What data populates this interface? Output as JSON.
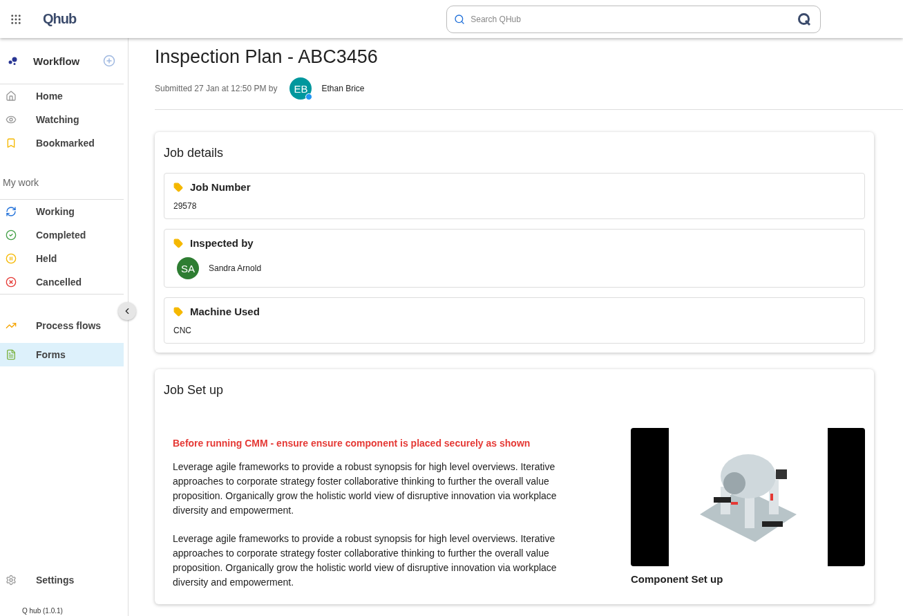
{
  "header": {
    "logo": "Qhub",
    "search": {
      "placeholder": "Search QHub"
    }
  },
  "sidebar": {
    "title": "Workflow",
    "groups": [
      {
        "items": [
          {
            "label": "Home",
            "selected": false
          },
          {
            "label": "Watching",
            "selected": false
          },
          {
            "label": "Bookmarked",
            "selected": false
          }
        ]
      },
      {
        "heading": "My work",
        "items": [
          {
            "label": "Working",
            "selected": false
          },
          {
            "label": "Completed",
            "selected": false
          },
          {
            "label": "Held",
            "selected": false
          },
          {
            "label": "Cancelled",
            "selected": false
          }
        ]
      },
      {
        "items": [
          {
            "label": "Process flows",
            "selected": false
          },
          {
            "label": "Forms",
            "selected": true
          }
        ]
      }
    ],
    "settings": "Settings",
    "version": "Q hub (1.0.1)"
  },
  "page": {
    "title": "Inspection Plan - ABC3456",
    "submitted": "Submitted 27 Jan at 12:50 PM by",
    "submitter": {
      "initials": "EB",
      "name": "Ethan Brice",
      "color": "#00979d",
      "online": true
    }
  },
  "job_details": {
    "title": "Job details",
    "fields": [
      {
        "kind": "text",
        "label": "Job Number",
        "value": "29578"
      },
      {
        "kind": "person",
        "label": "Inspected by",
        "initials": "SA",
        "name": "Sandra Arnold",
        "color": "#2e7d32"
      },
      {
        "kind": "text",
        "label": "Machine Used",
        "value": "CNC"
      }
    ]
  },
  "job_setup": {
    "title": "Job Set up",
    "warning": "Before running CMM - ensure ensure component is placed securely as shown",
    "paragraphs": [
      "Leverage agile frameworks to provide a robust synopsis for high level overviews. Iterative approaches to corporate strategy foster collaborative thinking to further the overall value proposition. Organically grow the holistic world view of disruptive innovation via workplace diversity and empowerment.",
      "Leverage agile frameworks to provide a robust synopsis for high level overviews. Iterative approaches to corporate strategy foster collaborative thinking to further the overall value proposition. Organically grow the holistic world view of disruptive innovation via workplace diversity and empowerment."
    ],
    "image_caption": "Component Set up"
  }
}
